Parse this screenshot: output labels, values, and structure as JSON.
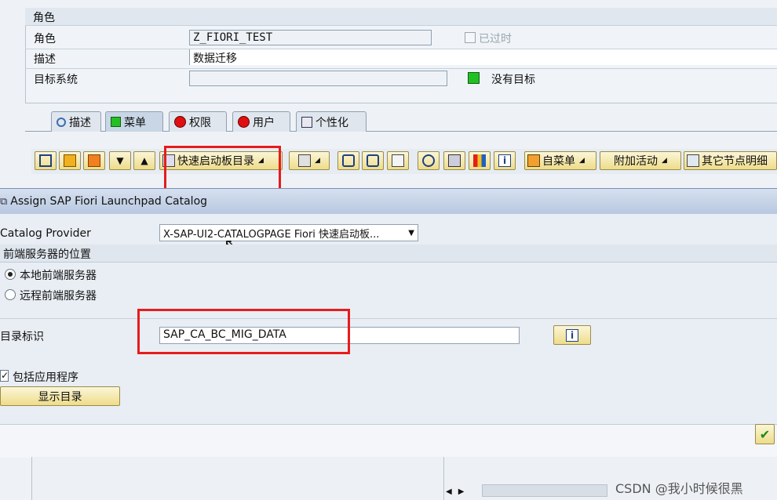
{
  "role_group": {
    "title": "角色",
    "role_label": "角色",
    "role_value": "Z_FIORI_TEST",
    "outdated_label": "已过时",
    "desc_label": "描述",
    "desc_value": "数据迁移",
    "target_label": "目标系统",
    "target_value": "",
    "no_target_label": "没有目标"
  },
  "tabs": [
    {
      "label": "描述"
    },
    {
      "label": "菜单"
    },
    {
      "label": "权限"
    },
    {
      "label": "用户"
    },
    {
      "label": "个性化"
    }
  ],
  "toolbar": {
    "launchpad_catalog_label": "快速启动板目录",
    "self_menu_label": "自菜单",
    "extra_activity_label": "附加活动",
    "other_node_label": "其它节点明细"
  },
  "dialog": {
    "title": "Assign SAP Fiori Launchpad Catalog",
    "catalog_provider_label": "Catalog Provider",
    "catalog_provider_value": "X-SAP-UI2-CATALOGPAGE Fiori 快速启动板...",
    "frontend_location_title": "前端服务器的位置",
    "local_server_label": "本地前端服务器",
    "remote_server_label": "远程前端服务器",
    "catalog_id_label": "目录标识",
    "catalog_id_value": "SAP_CA_BC_MIG_DATA",
    "include_apps_label": "包括应用程序",
    "show_catalog_label": "显示目录"
  },
  "watermark": "CSDN @我小时候很黑",
  "colors": {
    "highlight_red": "#e61c1c",
    "sap_button": "#eedc8a",
    "status_green": "#22c022"
  }
}
